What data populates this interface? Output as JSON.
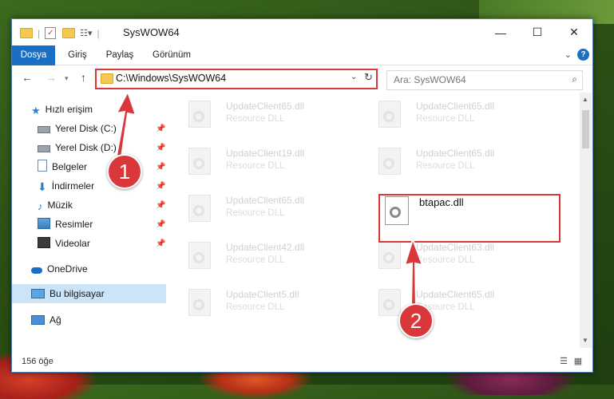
{
  "window": {
    "title": "SysWOW64",
    "controls": {
      "minimize": "—",
      "maximize": "☐",
      "close": "✕"
    }
  },
  "ribbon": {
    "tabs": [
      "Dosya",
      "Giriş",
      "Paylaş",
      "Görünüm"
    ],
    "help": "?"
  },
  "address": {
    "path": "C:\\Windows\\SysWOW64",
    "search_placeholder": "Ara: SysWOW64"
  },
  "nav_pane": {
    "quick_access": "Hızlı erişim",
    "items": [
      {
        "label": "Yerel Disk (C:)",
        "icon": "drive-icon"
      },
      {
        "label": "Yerel Disk (D:)",
        "icon": "drive-icon"
      },
      {
        "label": "Belgeler",
        "icon": "documents-icon"
      },
      {
        "label": "İndirmeler",
        "icon": "download-icon"
      },
      {
        "label": "Müzik",
        "icon": "music-icon"
      },
      {
        "label": "Resimler",
        "icon": "pictures-icon"
      },
      {
        "label": "Videolar",
        "icon": "video-icon"
      }
    ],
    "onedrive": "OneDrive",
    "this_pc": "Bu bilgisayar",
    "network": "Ağ"
  },
  "files": [
    {
      "name": "UpdateClient65.dll",
      "type": "Resource DLL"
    },
    {
      "name": "UpdateClient65.dll",
      "type": "Resource DLL"
    },
    {
      "name": "UpdateClient19.dll",
      "type": "Resource DLL"
    },
    {
      "name": "UpdateClient65.dll",
      "type": "Resource DLL"
    },
    {
      "name": "UpdateClient65.dll",
      "type": "Resource DLL"
    },
    {
      "name": "btapac.dll",
      "type": ""
    },
    {
      "name": "UpdateClient42.dll",
      "type": "Resource DLL"
    },
    {
      "name": "UpdateClient63.dll",
      "type": "Resource DLL"
    },
    {
      "name": "UpdateClient5.dll",
      "type": "Resource DLL"
    },
    {
      "name": "UpdateClient65.dll",
      "type": "Resource DLL"
    }
  ],
  "status": {
    "count": "156 öğe"
  },
  "annotations": {
    "step1": "1",
    "step2": "2"
  },
  "colors": {
    "accent": "#1a6fc4",
    "highlight": "#d9373a",
    "selection": "#cce4f7"
  }
}
